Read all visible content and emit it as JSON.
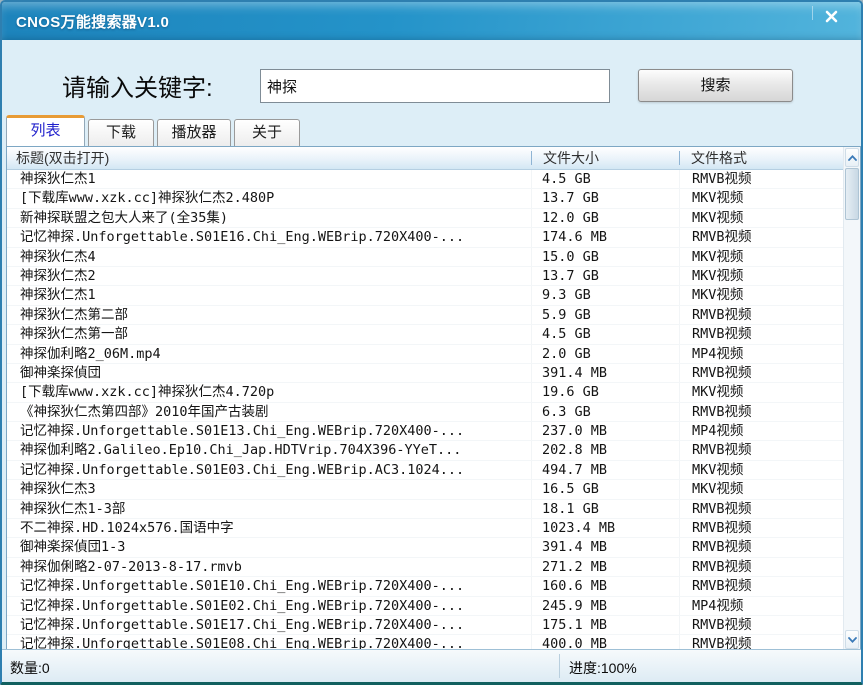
{
  "window": {
    "title": "CNOS万能搜索器V1.0"
  },
  "search": {
    "label": "请输入关键字:",
    "value": "神探",
    "button_label": "搜索"
  },
  "tabs": [
    {
      "label": "列表",
      "active": true
    },
    {
      "label": "下载",
      "active": false
    },
    {
      "label": "播放器",
      "active": false
    },
    {
      "label": "关于",
      "active": false
    }
  ],
  "table": {
    "columns": [
      "标题(双击打开)",
      "文件大小",
      "文件格式"
    ],
    "rows": [
      [
        "神探狄仁杰1",
        "4.5 GB",
        "RMVB视频"
      ],
      [
        "[下载库www.xzk.cc]神探狄仁杰2.480P",
        "13.7 GB",
        "MKV视频"
      ],
      [
        "新神探联盟之包大人来了(全35集)",
        "12.0 GB",
        "MKV视频"
      ],
      [
        "记忆神探.Unforgettable.S01E16.Chi_Eng.WEBrip.720X400-...",
        "174.6 MB",
        "RMVB视频"
      ],
      [
        "神探狄仁杰4",
        "15.0 GB",
        "MKV视频"
      ],
      [
        "神探狄仁杰2",
        "13.7 GB",
        "MKV视频"
      ],
      [
        "神探狄仁杰1",
        "9.3 GB",
        "MKV视频"
      ],
      [
        "神探狄仁杰第二部",
        "5.9 GB",
        "RMVB视频"
      ],
      [
        "神探狄仁杰第一部",
        "4.5 GB",
        "RMVB视频"
      ],
      [
        "神探伽利略2_06M.mp4",
        "2.0 GB",
        "MP4视频"
      ],
      [
        "御神楽探偵団",
        "391.4 MB",
        "RMVB视频"
      ],
      [
        "[下载库www.xzk.cc]神探狄仁杰4.720p",
        "19.6 GB",
        "MKV视频"
      ],
      [
        "《神探狄仁杰第四部》2010年国产古装剧",
        "6.3 GB",
        "RMVB视频"
      ],
      [
        "记忆神探.Unforgettable.S01E13.Chi_Eng.WEBrip.720X400-...",
        "237.0 MB",
        "MP4视频"
      ],
      [
        "神探伽利略2.Galileo.Ep10.Chi_Jap.HDTVrip.704X396-YYeT...",
        "202.8 MB",
        "RMVB视频"
      ],
      [
        "记忆神探.Unforgettable.S01E03.Chi_Eng.WEBrip.AC3.1024...",
        "494.7 MB",
        "MKV视频"
      ],
      [
        "神探狄仁杰3",
        "16.5 GB",
        "MKV视频"
      ],
      [
        "神探狄仁杰1-3部",
        "18.1 GB",
        "RMVB视频"
      ],
      [
        "不二神探.HD.1024x576.国语中字",
        "1023.4 MB",
        "RMVB视频"
      ],
      [
        "御神楽探偵団1-3",
        "391.4 MB",
        "RMVB视频"
      ],
      [
        "神探伽俐略2-07-2013-8-17.rmvb",
        "271.2 MB",
        "RMVB视频"
      ],
      [
        "记忆神探.Unforgettable.S01E10.Chi_Eng.WEBrip.720X400-...",
        "160.6 MB",
        "RMVB视频"
      ],
      [
        "记忆神探.Unforgettable.S01E02.Chi_Eng.WEBrip.720X400-...",
        "245.9 MB",
        "MP4视频"
      ],
      [
        "记忆神探.Unforgettable.S01E17.Chi_Eng.WEBrip.720X400-...",
        "175.1 MB",
        "RMVB视频"
      ],
      [
        "记忆神探.Unforgettable.S01E08.Chi_Eng.WEBrip.720X400-...",
        "400.0 MB",
        "RMVB视频"
      ]
    ]
  },
  "status": {
    "count_label": "数量:0",
    "progress_label": "进度:100%"
  },
  "colors": {
    "titlebar_left": "#1d84bc",
    "titlebar_right": "#52b4dc",
    "tab_accent_orange": "#e89b35",
    "tab_active_text": "#2121cc",
    "scroll_arrow_blue": "#3a7ab8",
    "window_border": "#2e7fb0"
  }
}
